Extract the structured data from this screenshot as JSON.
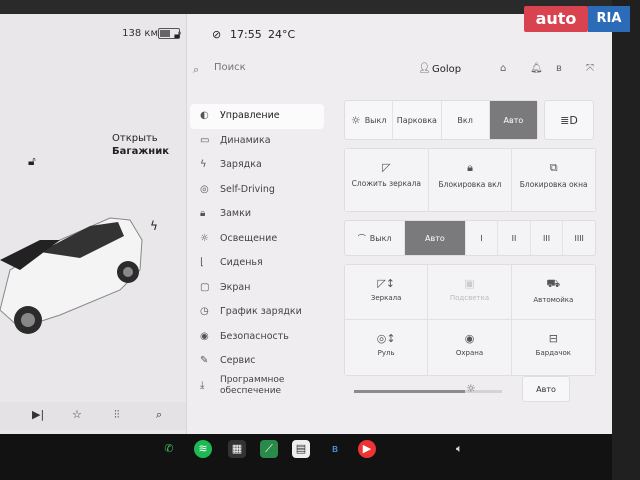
{
  "status": {
    "range": "138 км",
    "time": "17:55",
    "temperature": "24°C"
  },
  "car_panel": {
    "trunk_label_line1": "Открыть",
    "trunk_label_line2": "Багажник"
  },
  "search": {
    "placeholder": "Поиск"
  },
  "user": {
    "name": "Golop"
  },
  "menu": [
    {
      "label": "Управление",
      "icon": "toggle-icon",
      "glyph": "◐",
      "active": true
    },
    {
      "label": "Динамика",
      "icon": "car-icon",
      "glyph": "▭"
    },
    {
      "label": "Зарядка",
      "icon": "bolt-icon",
      "glyph": "ϟ"
    },
    {
      "label": "Self-Driving",
      "icon": "steering-wheel-icon",
      "glyph": "◎"
    },
    {
      "label": "Замки",
      "icon": "lock-icon",
      "glyph": "🔒︎"
    },
    {
      "label": "Освещение",
      "icon": "light-icon",
      "glyph": "☼"
    },
    {
      "label": "Сиденья",
      "icon": "seat-icon",
      "glyph": "⌊"
    },
    {
      "label": "Экран",
      "icon": "screen-icon",
      "glyph": "▢"
    },
    {
      "label": "График зарядки",
      "icon": "clock-icon",
      "glyph": "◷"
    },
    {
      "label": "Безопасность",
      "icon": "shield-icon",
      "glyph": "◉"
    },
    {
      "label": "Сервис",
      "icon": "wrench-icon",
      "glyph": "✎"
    },
    {
      "label": "Программное обеспечение",
      "icon": "download-icon",
      "glyph": "⤓"
    }
  ],
  "headlights": {
    "options": [
      "Выкл",
      "Парковка",
      "Вкл",
      "Авто"
    ],
    "selected": "Авто"
  },
  "controls": {
    "fold_mirrors": "Сложить зеркала",
    "window_lock": "Блокировка окна",
    "child_lock": "Блокировка вкл"
  },
  "wipers": {
    "off": "Выкл",
    "auto": "Авто",
    "speeds": [
      "I",
      "II",
      "III",
      "IIII"
    ],
    "selected": "Авто"
  },
  "adjust": {
    "mirrors": "Зеркала",
    "headlights": "Подсветка",
    "autopark": "Автомойка",
    "steering": "Руль",
    "sentry": "Охрана",
    "glovebox": "Бардачок"
  },
  "brightness": {
    "level": 0.75,
    "auto_label": "Авто"
  },
  "watermark": {
    "brand": "auto",
    "suffix": "RIA"
  },
  "colors": {
    "selected_segment": "#7a797b",
    "screen_bg": "#efedf0"
  }
}
